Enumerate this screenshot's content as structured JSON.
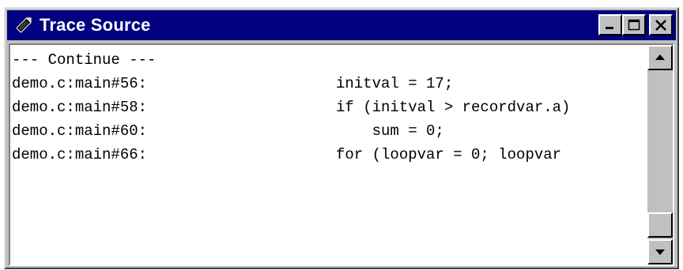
{
  "window": {
    "title": "Trace Source",
    "titlebar_color": "#000080",
    "icon": "pen-icon"
  },
  "caption_buttons": [
    {
      "name": "minimize-button",
      "icon": "minimize-icon"
    },
    {
      "name": "maximize-button",
      "icon": "maximize-icon"
    },
    {
      "name": "close-button",
      "icon": "close-icon"
    }
  ],
  "trace": {
    "lines": [
      {
        "location": "--- Continue ---",
        "code": ""
      },
      {
        "location": "demo.c:main#56:",
        "code": "initval = 17;"
      },
      {
        "location": "demo.c:main#58:",
        "code": "if (initval > recordvar.a)"
      },
      {
        "location": "demo.c:main#60:",
        "code": "    sum = 0;"
      },
      {
        "location": "demo.c:main#66:",
        "code": "for (loopvar = 0; loopvar"
      }
    ]
  },
  "scrollbar": {
    "up_icon": "arrow-up-icon",
    "down_icon": "arrow-down-icon",
    "position": 1.0
  }
}
